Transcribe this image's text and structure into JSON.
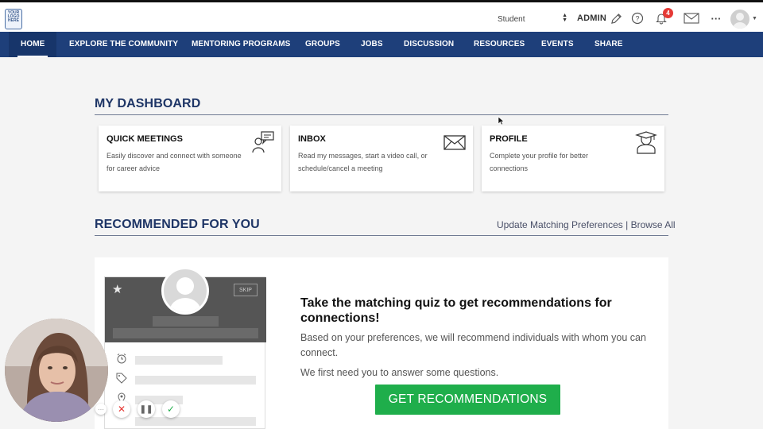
{
  "topbar": {
    "logo_text": "YOUR LOGO HERE",
    "role_value": "Student",
    "admin_label": "ADMIN",
    "notification_count": "4"
  },
  "nav": {
    "items": [
      "HOME",
      "EXPLORE THE COMMUNITY",
      "MENTORING PROGRAMS",
      "GROUPS",
      "JOBS",
      "DISCUSSION",
      "RESOURCES",
      "EVENTS",
      "SHARE"
    ],
    "active": "HOME"
  },
  "dashboard": {
    "title": "MY DASHBOARD",
    "cards": [
      {
        "title": "QUICK MEETINGS",
        "desc": "Easily discover and connect with someone for career advice",
        "icon": "meeting-icon"
      },
      {
        "title": "INBOX",
        "desc": "Read my messages, start a video call, or schedule/cancel a meeting",
        "icon": "envelope-icon"
      },
      {
        "title": "PROFILE",
        "desc": "Complete your profile for better connections",
        "icon": "graduate-icon"
      }
    ]
  },
  "recommended": {
    "title": "RECOMMENDED FOR YOU",
    "update_link": "Update Matching Preferences",
    "separator": "|",
    "browse_link": "Browse All"
  },
  "quiz": {
    "skip_label": "SKIP",
    "title": "Take the matching quiz to get recommendations for connections!",
    "text1": "Based on your preferences, we will recommend individuals with whom you can connect.",
    "text2": "We first need you to answer some questions.",
    "button": "GET RECOMMENDATIONS"
  },
  "colors": {
    "nav_bg": "#1e3f7a",
    "heading": "#1e3566",
    "cta": "#1fae4b",
    "badge": "#e53935"
  }
}
